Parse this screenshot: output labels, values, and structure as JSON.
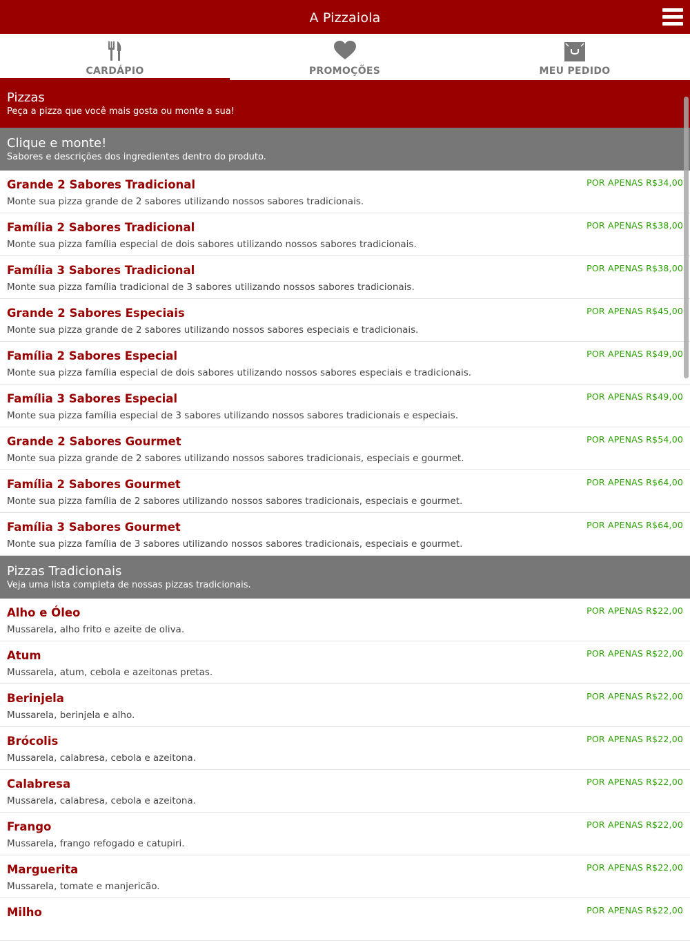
{
  "app": {
    "title": "A Pizzaiola"
  },
  "tabs": [
    {
      "label": "CARDÁPIO",
      "icon": "fork-knife-icon",
      "active": true
    },
    {
      "label": "PROMOÇÕES",
      "icon": "heart-icon",
      "active": false
    },
    {
      "label": "MEU PEDIDO",
      "icon": "shopping-bag-icon",
      "active": false
    }
  ],
  "category": {
    "title": "Pizzas",
    "subtitle": "Peça a pizza que você mais gosta ou monte a sua!"
  },
  "sections": [
    {
      "title": "Clique e monte!",
      "subtitle": "Sabores e descrições dos ingredientes dentro do produto.",
      "items": [
        {
          "name": "Grande 2 Sabores Tradicional",
          "desc": "Monte sua pizza grande de 2 sabores utilizando nossos sabores tradicionais.",
          "price": "POR APENAS R$34,00"
        },
        {
          "name": "Família 2 Sabores Tradicional",
          "desc": "Monte sua pizza família especial de dois sabores utilizando nossos sabores tradicionais.",
          "price": "POR APENAS R$38,00"
        },
        {
          "name": "Família 3 Sabores Tradicional",
          "desc": "Monte sua pizza família tradicional de 3 sabores utilizando nossos sabores tradicionais.",
          "price": "POR APENAS R$38,00"
        },
        {
          "name": "Grande 2 Sabores Especiais",
          "desc": "Monte sua pizza grande de 2 sabores utilizando nossos sabores especiais e tradicionais.",
          "price": "POR APENAS R$45,00"
        },
        {
          "name": "Família 2 Sabores Especial",
          "desc": "Monte sua pizza família especial de dois sabores utilizando nossos sabores especiais e tradicionais.",
          "price": "POR APENAS R$49,00"
        },
        {
          "name": "Família 3 Sabores Especial",
          "desc": "Monte sua pizza família especial de 3 sabores utilizando nossos sabores tradicionais e especiais.",
          "price": "POR APENAS R$49,00"
        },
        {
          "name": "Grande 2 Sabores Gourmet",
          "desc": "Monte sua pizza grande de 2 sabores utilizando nossos sabores tradicionais, especiais e gourmet.",
          "price": "POR APENAS R$54,00"
        },
        {
          "name": "Família 2 Sabores Gourmet",
          "desc": "Monte sua pizza família de 2 sabores utilizando nossos sabores tradicionais, especiais e gourmet.",
          "price": "POR APENAS R$64,00"
        },
        {
          "name": "Família 3 Sabores Gourmet",
          "desc": "Monte sua pizza família de 3 sabores utilizando nossos sabores tradicionais, especiais e gourmet.",
          "price": "POR APENAS R$64,00"
        }
      ]
    },
    {
      "title": "Pizzas Tradicionais",
      "subtitle": "Veja uma lista completa de nossas pizzas tradicionais.",
      "items": [
        {
          "name": "Alho e Óleo",
          "desc": "Mussarela, alho frito e azeite de oliva.",
          "price": "POR APENAS R$22,00"
        },
        {
          "name": "Atum",
          "desc": "Mussarela, atum, cebola e azeitonas pretas.",
          "price": "POR APENAS R$22,00"
        },
        {
          "name": "Berinjela",
          "desc": "Mussarela, berinjela e alho.",
          "price": "POR APENAS R$22,00"
        },
        {
          "name": "Brócolis",
          "desc": "Mussarela, calabresa, cebola e azeitona.",
          "price": "POR APENAS R$22,00"
        },
        {
          "name": "Calabresa",
          "desc": "Mussarela, calabresa, cebola e azeitona.",
          "price": "POR APENAS R$22,00"
        },
        {
          "name": "Frango",
          "desc": "Mussarela, frango refogado e catupiri.",
          "price": "POR APENAS R$22,00"
        },
        {
          "name": "Marguerita",
          "desc": "Mussarela, tomate e manjericão.",
          "price": "POR APENAS R$22,00"
        },
        {
          "name": "Milho",
          "desc": "",
          "price": "POR APENAS R$22,00"
        }
      ]
    }
  ]
}
